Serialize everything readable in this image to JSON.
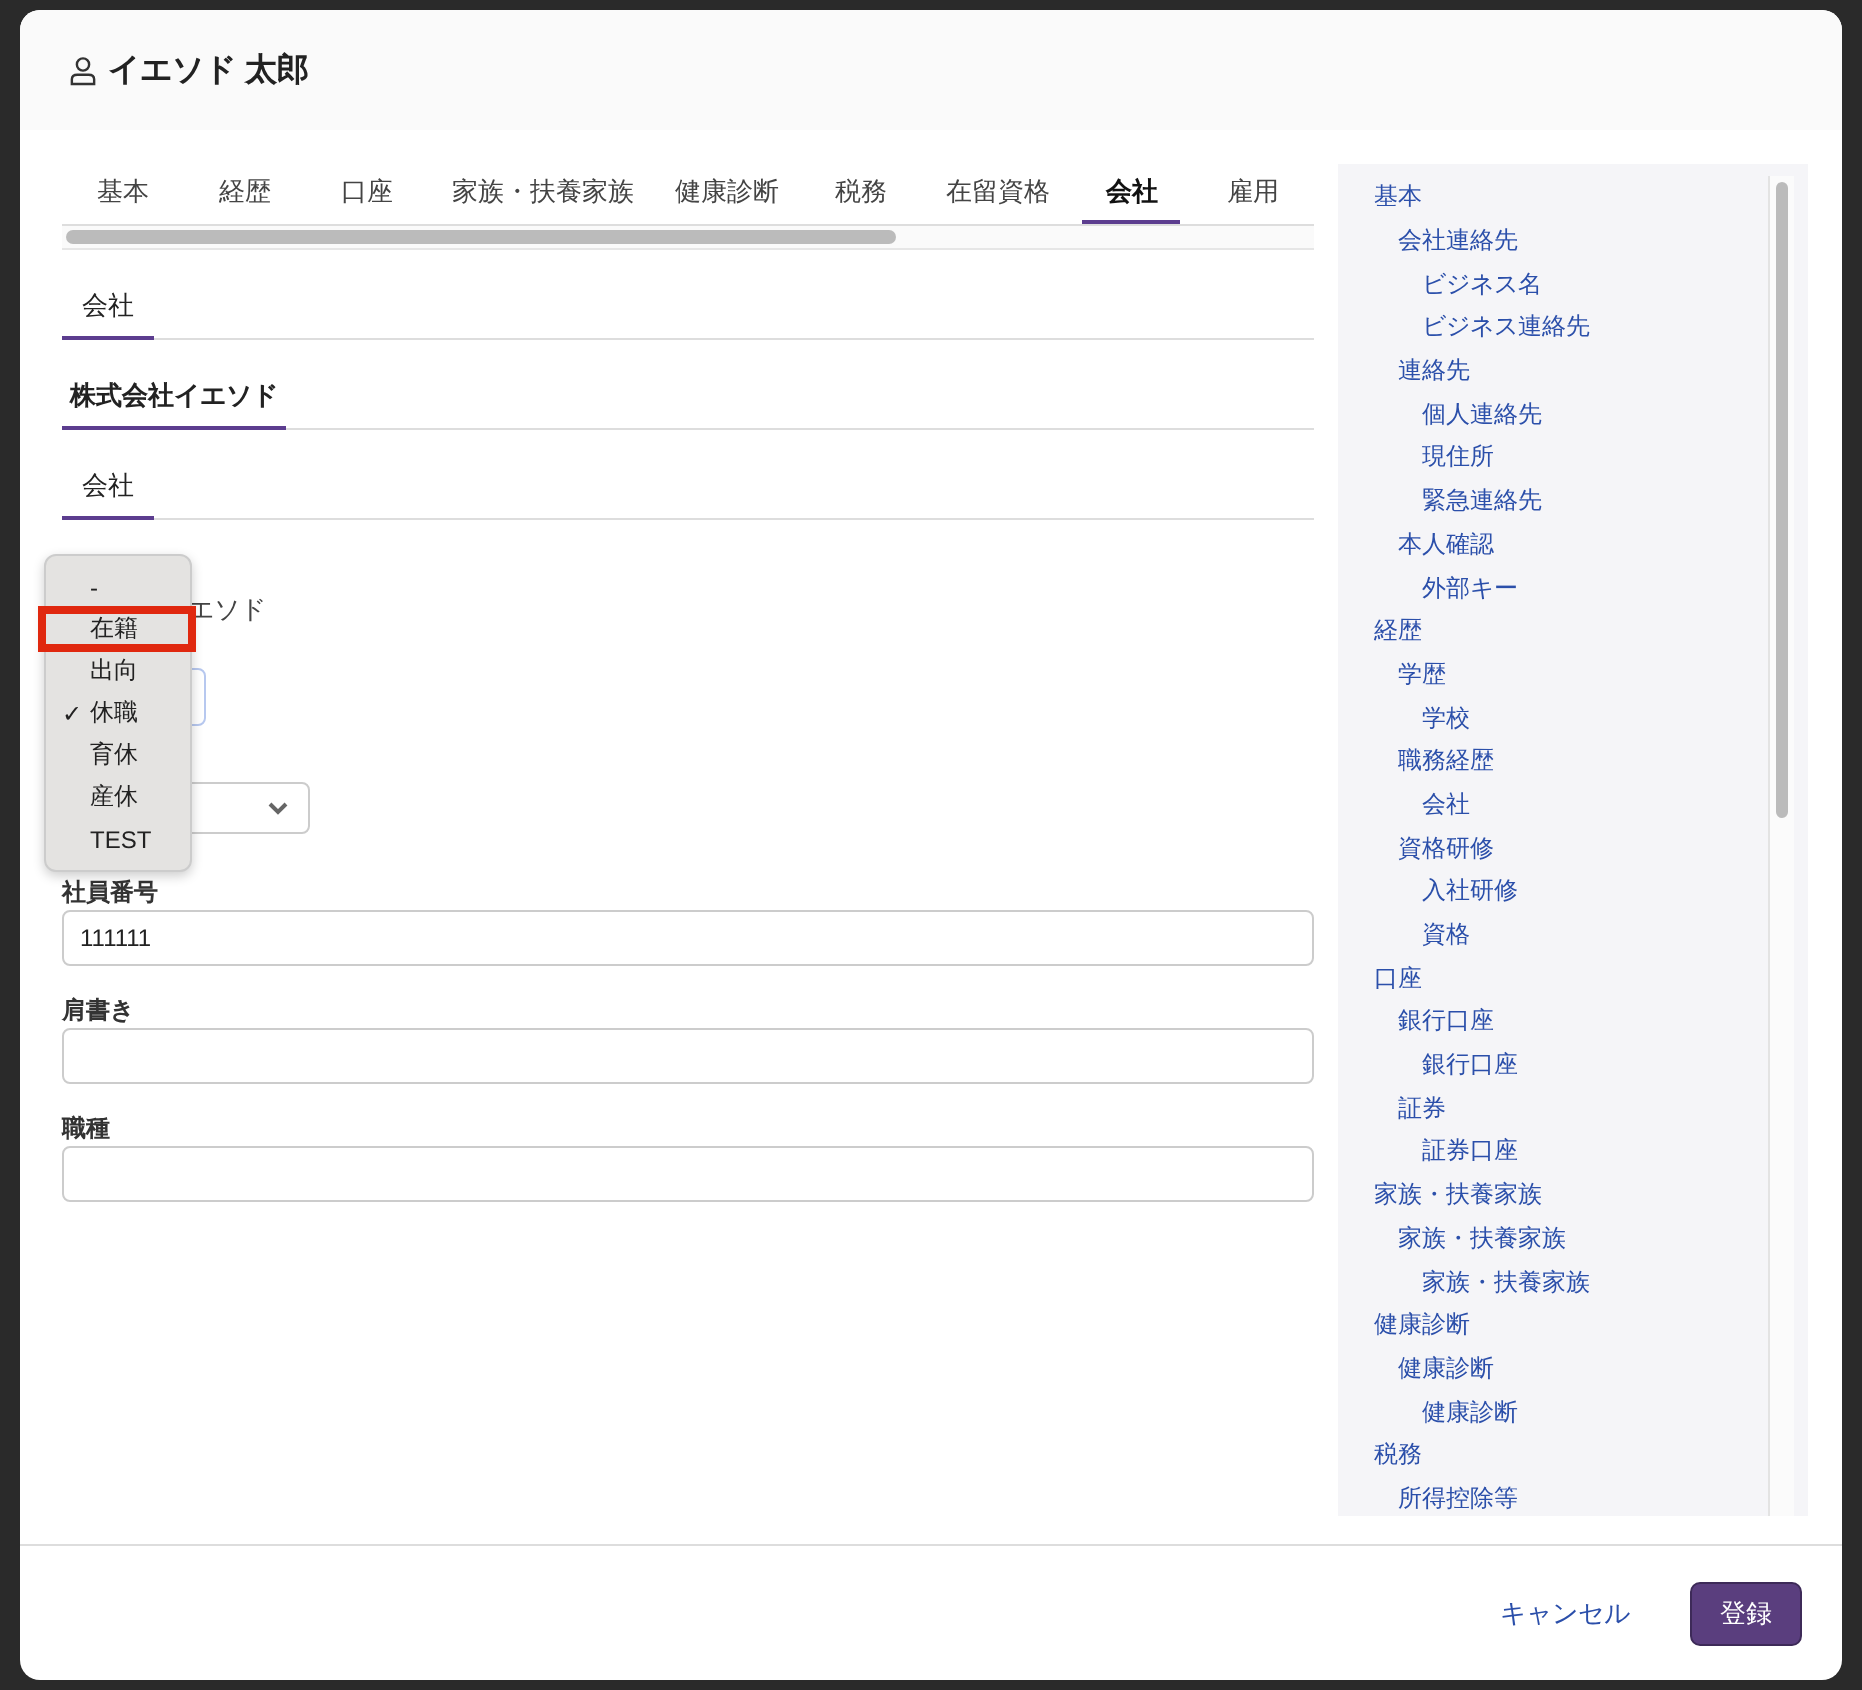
{
  "modal": {
    "title": "イエソド 太郎"
  },
  "tabs": [
    {
      "label": "基本",
      "selected": false
    },
    {
      "label": "経歴",
      "selected": false
    },
    {
      "label": "口座",
      "selected": false
    },
    {
      "label": "家族・扶養家族",
      "selected": false
    },
    {
      "label": "健康診断",
      "selected": false
    },
    {
      "label": "税務",
      "selected": false
    },
    {
      "label": "在留資格",
      "selected": false
    },
    {
      "label": "会社",
      "selected": true
    },
    {
      "label": "雇用",
      "selected": false
    }
  ],
  "section_title": "会社",
  "company_name": "株式会社イエソド",
  "subsection_title": "会社",
  "partial_value": "エソド",
  "dropdown": {
    "options": [
      {
        "label": "-",
        "checked": false,
        "highlighted": false
      },
      {
        "label": "在籍",
        "checked": false,
        "highlighted": true
      },
      {
        "label": "出向",
        "checked": false,
        "highlighted": false
      },
      {
        "label": "休職",
        "checked": true,
        "highlighted": false
      },
      {
        "label": "育休",
        "checked": false,
        "highlighted": false
      },
      {
        "label": "産休",
        "checked": false,
        "highlighted": false
      },
      {
        "label": "TEST",
        "checked": false,
        "highlighted": false
      }
    ],
    "check_mark": "✓"
  },
  "fields": [
    {
      "label": "社員番号",
      "value": "111111"
    },
    {
      "label": "肩書き"
    },
    {
      "label": "職種"
    }
  ],
  "outline": [
    {
      "label": "基本",
      "children": [
        {
          "label": "会社連絡先",
          "children": [
            {
              "label": "ビジネス名"
            },
            {
              "label": "ビジネス連絡先"
            }
          ]
        },
        {
          "label": "連絡先",
          "children": [
            {
              "label": "個人連絡先"
            },
            {
              "label": "現住所"
            },
            {
              "label": "緊急連絡先"
            }
          ]
        },
        {
          "label": "本人確認",
          "children": [
            {
              "label": "外部キー"
            }
          ]
        }
      ]
    },
    {
      "label": "経歴",
      "children": [
        {
          "label": "学歴",
          "children": [
            {
              "label": "学校"
            }
          ]
        },
        {
          "label": "職務経歴",
          "children": [
            {
              "label": "会社"
            }
          ]
        },
        {
          "label": "資格研修",
          "children": [
            {
              "label": "入社研修"
            },
            {
              "label": "資格"
            }
          ]
        }
      ]
    },
    {
      "label": "口座",
      "children": [
        {
          "label": "銀行口座",
          "children": [
            {
              "label": "銀行口座"
            }
          ]
        },
        {
          "label": "証券",
          "children": [
            {
              "label": "証券口座"
            }
          ]
        }
      ]
    },
    {
      "label": "家族・扶養家族",
      "children": [
        {
          "label": "家族・扶養家族",
          "children": [
            {
              "label": "家族・扶養家族"
            }
          ]
        }
      ]
    },
    {
      "label": "健康診断",
      "children": [
        {
          "label": "健康診断",
          "children": [
            {
              "label": "健康診断"
            }
          ]
        }
      ]
    },
    {
      "label": "税務",
      "children": [
        {
          "label": "所得控除等"
        }
      ]
    }
  ],
  "footer": {
    "cancel": "キャンセル",
    "submit": "登録"
  }
}
